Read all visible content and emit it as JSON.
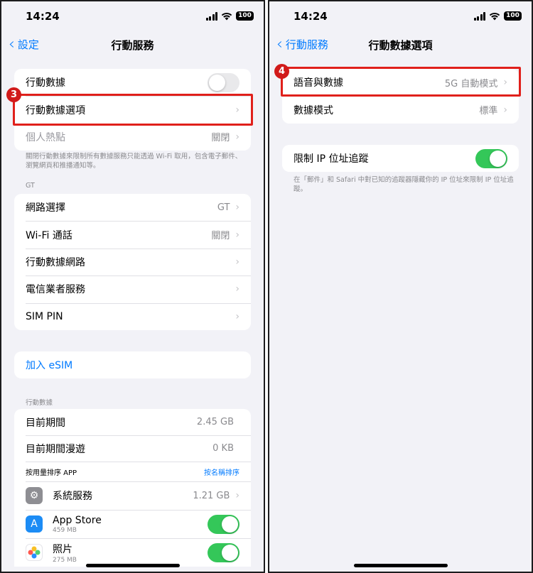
{
  "left": {
    "status_time": "14:24",
    "battery": "100",
    "back_label": "設定",
    "title": "行動服務",
    "group1": [
      {
        "label": "行動數據",
        "toggle": false
      },
      {
        "label": "行動數據選項"
      },
      {
        "label": "個人熱點",
        "value": "關閉"
      }
    ],
    "footnote": "關閉行動數據來限制所有數據服務只能透過 Wi-Fi 取用，包含電子郵件、瀏覽網頁和推播通知等。",
    "carrier_header": "GT",
    "group2": [
      {
        "label": "網路選擇",
        "value": "GT"
      },
      {
        "label": "Wi-Fi 通話",
        "value": "關閉"
      },
      {
        "label": "行動數據網路"
      },
      {
        "label": "電信業者服務"
      },
      {
        "label": "SIM PIN"
      }
    ],
    "esim_label": "加入 eSIM",
    "data_header": "行動數據",
    "usage": [
      {
        "label": "目前期間",
        "value": "2.45 GB"
      },
      {
        "label": "目前期間漫遊",
        "value": "0 KB"
      }
    ],
    "sort_label": "按用量排序 APP",
    "sort_link": "按名稱排序",
    "apps": [
      {
        "name": "系統服務",
        "value": "1.21 GB",
        "icon": "gear-icon",
        "color": "#8e8e93"
      },
      {
        "name": "App Store",
        "sub": "459 MB",
        "icon": "app-store-icon",
        "color": "#1c8cf5",
        "toggle": true
      },
      {
        "name": "照片",
        "sub": "275 MB",
        "icon": "photos-icon",
        "color": "#ffffff",
        "toggle": true
      }
    ],
    "step_badge": "3"
  },
  "right": {
    "status_time": "14:24",
    "battery": "100",
    "back_label": "行動服務",
    "title": "行動數據選項",
    "group1": [
      {
        "label": "語音與數據",
        "value": "5G 自動模式"
      },
      {
        "label": "數據模式",
        "value": "標準"
      }
    ],
    "limit_ip_label": "限制 IP 位址追蹤",
    "limit_ip_toggle": true,
    "footnote": "在「郵件」和 Safari 中對已知的追蹤器隱藏你的 IP 位址來限制 IP 位址追蹤。",
    "step_badge": "4"
  },
  "colors": {
    "accent": "#007aff",
    "toggle_on": "#34c759",
    "highlight": "#e0201b"
  }
}
